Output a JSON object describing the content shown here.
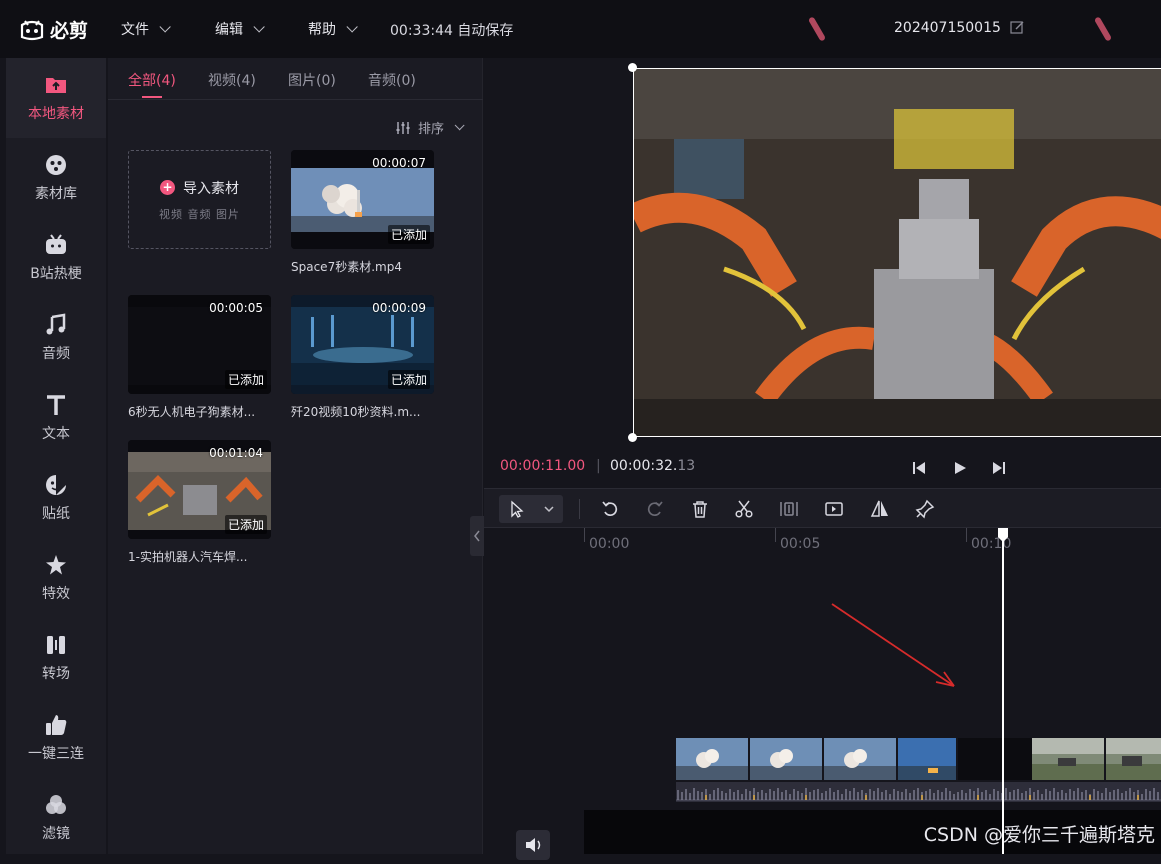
{
  "app": {
    "name": "必剪",
    "menus": [
      {
        "label": "文件"
      },
      {
        "label": "编辑"
      },
      {
        "label": "帮助"
      }
    ],
    "autosave": "00:33:44 自动保存",
    "project_name": "202407150015"
  },
  "sidebar": {
    "items": [
      {
        "label": "本地素材",
        "icon": "upload-folder-icon",
        "active": true
      },
      {
        "label": "素材库",
        "icon": "media-library-icon"
      },
      {
        "label": "B站热梗",
        "icon": "bilibili-tv-icon"
      },
      {
        "label": "音频",
        "icon": "music-note-icon"
      },
      {
        "label": "文本",
        "icon": "text-t-icon"
      },
      {
        "label": "贴纸",
        "icon": "sticker-icon"
      },
      {
        "label": "特效",
        "icon": "effects-star-icon"
      },
      {
        "label": "转场",
        "icon": "transition-icon"
      },
      {
        "label": "一键三连",
        "icon": "thumbs-up-icon"
      },
      {
        "label": "滤镜",
        "icon": "filter-circles-icon"
      }
    ]
  },
  "media": {
    "tabs": [
      {
        "label": "全部(4)",
        "active": true
      },
      {
        "label": "视频(4)"
      },
      {
        "label": "图片(0)"
      },
      {
        "label": "音频(0)"
      }
    ],
    "sort_label": "排序",
    "import": {
      "title": "导入素材",
      "subtitle": "视频 音频 图片"
    },
    "clips": [
      {
        "name": "Space7秒素材.mp4",
        "duration": "00:00:07",
        "status": "已添加"
      },
      {
        "name": "6秒无人机电子狗素材...",
        "duration": "00:00:05",
        "status": "已添加"
      },
      {
        "name": "歼20视频10秒资料.m...",
        "duration": "00:00:09",
        "status": "已添加"
      },
      {
        "name": "1-实拍机器人汽车焊...",
        "duration": "00:01:04",
        "status": "已添加"
      }
    ]
  },
  "player": {
    "current_time_main": "00:00:11.",
    "current_time_frac": "00",
    "separator": "|",
    "total_time_main": "00:00:32.",
    "total_time_frac": "13"
  },
  "timeline": {
    "ruler_labels": [
      "00:00",
      "00:05",
      "00:10"
    ]
  },
  "watermark": "CSDN @爱你三千遍斯塔克",
  "colors": {
    "accent": "#f2577f",
    "background": "#15151c"
  }
}
